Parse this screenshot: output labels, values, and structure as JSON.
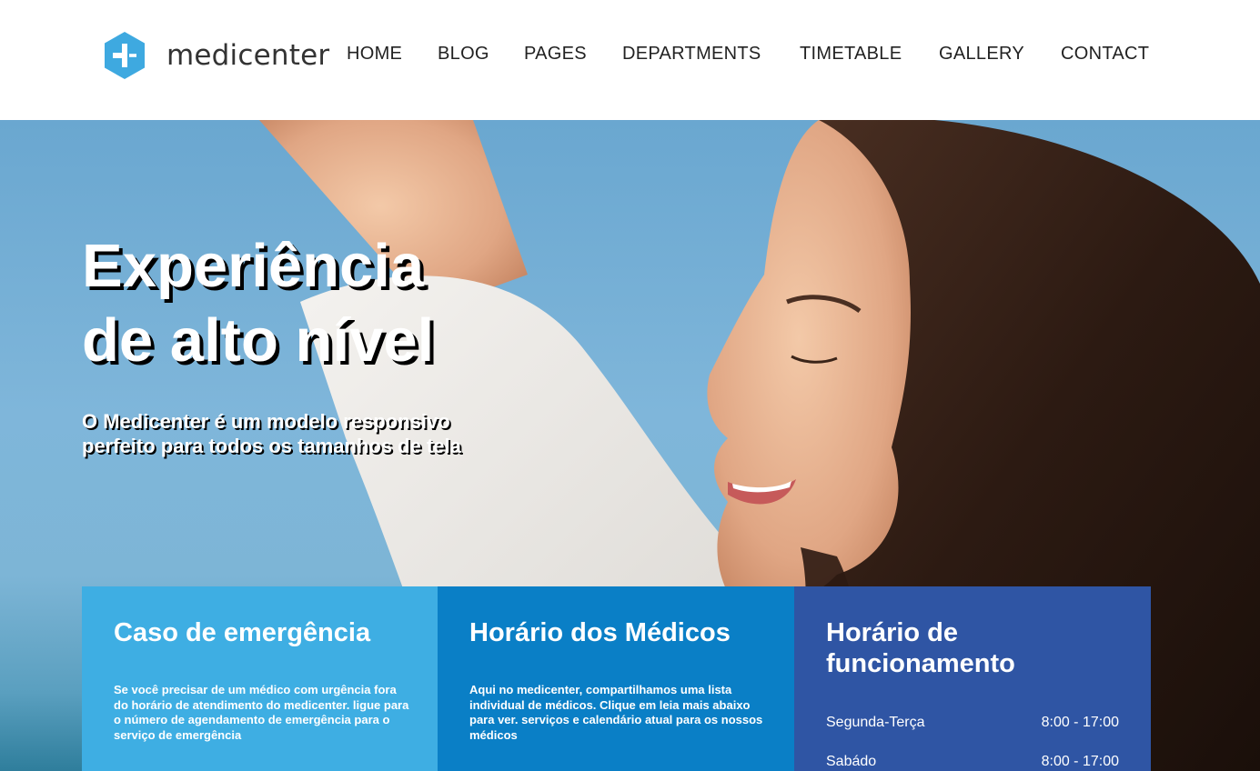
{
  "brand": {
    "name": "medicenter",
    "accent": "#3ea9e0",
    "logo_icon": "medical-cross-hexagon"
  },
  "nav": {
    "items": [
      {
        "label": "HOME"
      },
      {
        "label": "BLOG"
      },
      {
        "label": "PAGES"
      },
      {
        "label": "DEPARTMENTS"
      },
      {
        "label": "TIMETABLE"
      },
      {
        "label": "GALLERY"
      },
      {
        "label": "CONTACT"
      }
    ]
  },
  "hero": {
    "title_line1": "Experiência",
    "title_line2": "de alto nível",
    "subtitle": "O Medicenter é um modelo responsivo perfeito para todos os tamanhos de tela"
  },
  "boxes": {
    "emergency": {
      "title": "Caso de emergência",
      "text": "Se você precisar de um médico com urgência fora do horário de atendimento do medicenter. ligue para o número de agendamento de emergência para o serviço de emergência",
      "color": "#3eaee3"
    },
    "doctors": {
      "title": "Horário dos Médicos",
      "text": "Aqui no medicenter, compartilhamos uma lista individual de médicos. Clique em leia mais abaixo para ver. serviços e calendário atual para os nossos médicos",
      "color": "#0a7fc6"
    },
    "opening": {
      "title": "Horário de funcionamento",
      "color": "#2f55a4",
      "rows": [
        {
          "day": "Segunda-Terça",
          "hours": "8:00 - 17:00"
        },
        {
          "day": "Sabádo",
          "hours": "8:00 - 17:00"
        }
      ]
    }
  }
}
